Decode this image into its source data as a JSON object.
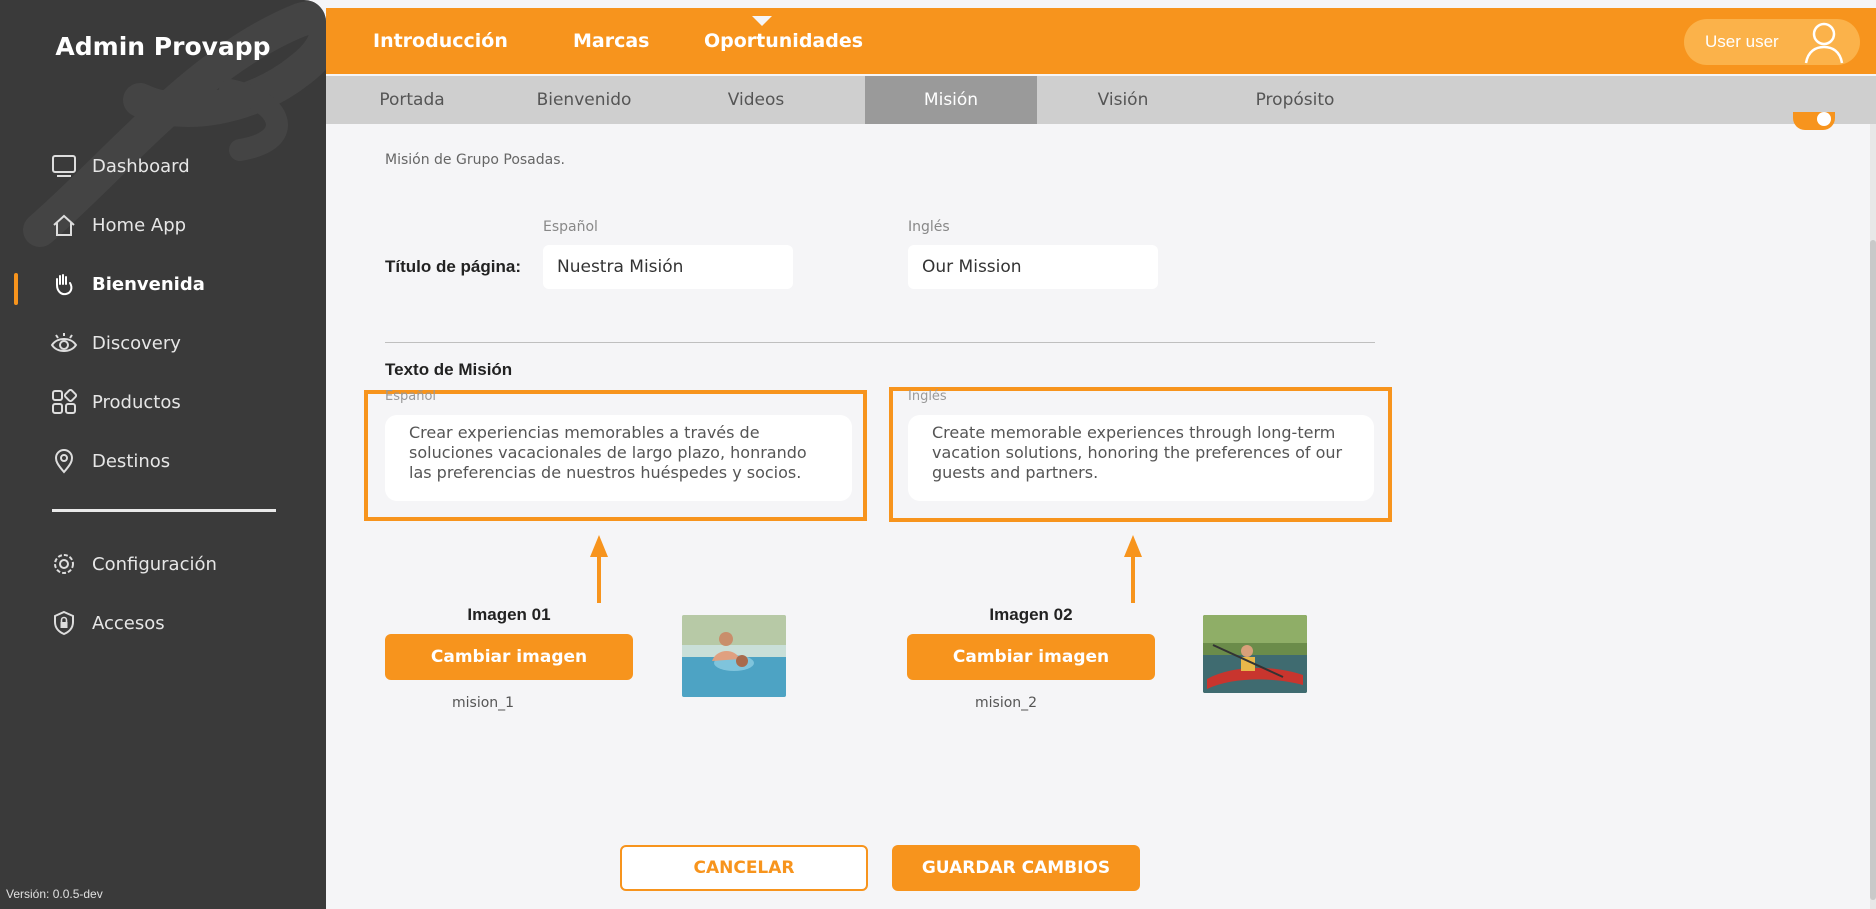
{
  "sidebar": {
    "title": "Admin Provapp",
    "items": [
      {
        "label": "Dashboard",
        "icon": "monitor-icon"
      },
      {
        "label": "Home App",
        "icon": "home-icon"
      },
      {
        "label": "Bienvenida",
        "icon": "waving-hand-icon",
        "active": true
      },
      {
        "label": "Discovery",
        "icon": "eye-icon"
      },
      {
        "label": "Productos",
        "icon": "grid-icon"
      },
      {
        "label": "Destinos",
        "icon": "map-pin-icon"
      }
    ],
    "settings_items": [
      {
        "label": "Configuración",
        "icon": "gear-icon"
      },
      {
        "label": "Accesos",
        "icon": "shield-lock-icon"
      }
    ],
    "version": "Versión: 0.0.5-dev"
  },
  "topnav": {
    "tabs": [
      "Introducción",
      "Marcas",
      "Oportunidades"
    ],
    "active_tab": "Introducción",
    "user_label": "User user"
  },
  "subnav": {
    "tabs": [
      "Portada",
      "Bienvenido",
      "Videos",
      "Misión",
      "Visión",
      "Propósito"
    ],
    "active_tab": "Misión"
  },
  "content": {
    "description": "Misión de Grupo Posadas.",
    "lang_es": "Español",
    "lang_en": "Inglés",
    "page_title_label": "Título de página:",
    "page_title_es": "Nuestra Misión",
    "page_title_en": "Our Mission",
    "section_title": "Texto de Misión",
    "mission_es": "Crear experiencias memorables a través de soluciones vacacionales de largo plazo, honrando las preferencias de nuestros huéspedes y socios.",
    "mission_en": "Create memorable experiences through long-term vacation solutions, honoring the preferences of our guests and partners.",
    "image1": {
      "label": "Imagen 01",
      "button": "Cambiar imagen",
      "file": "mision_1"
    },
    "image2": {
      "label": "Imagen 02",
      "button": "Cambiar imagen",
      "file": "mision_2"
    }
  },
  "actions": {
    "cancel": "CANCELAR",
    "save": "GUARDAR CAMBIOS"
  },
  "colors": {
    "accent": "#f7941d",
    "sidebar_bg": "#3a3a3a",
    "subnav_bg": "#cfcfcf",
    "subnav_active": "#9a9a9a"
  }
}
